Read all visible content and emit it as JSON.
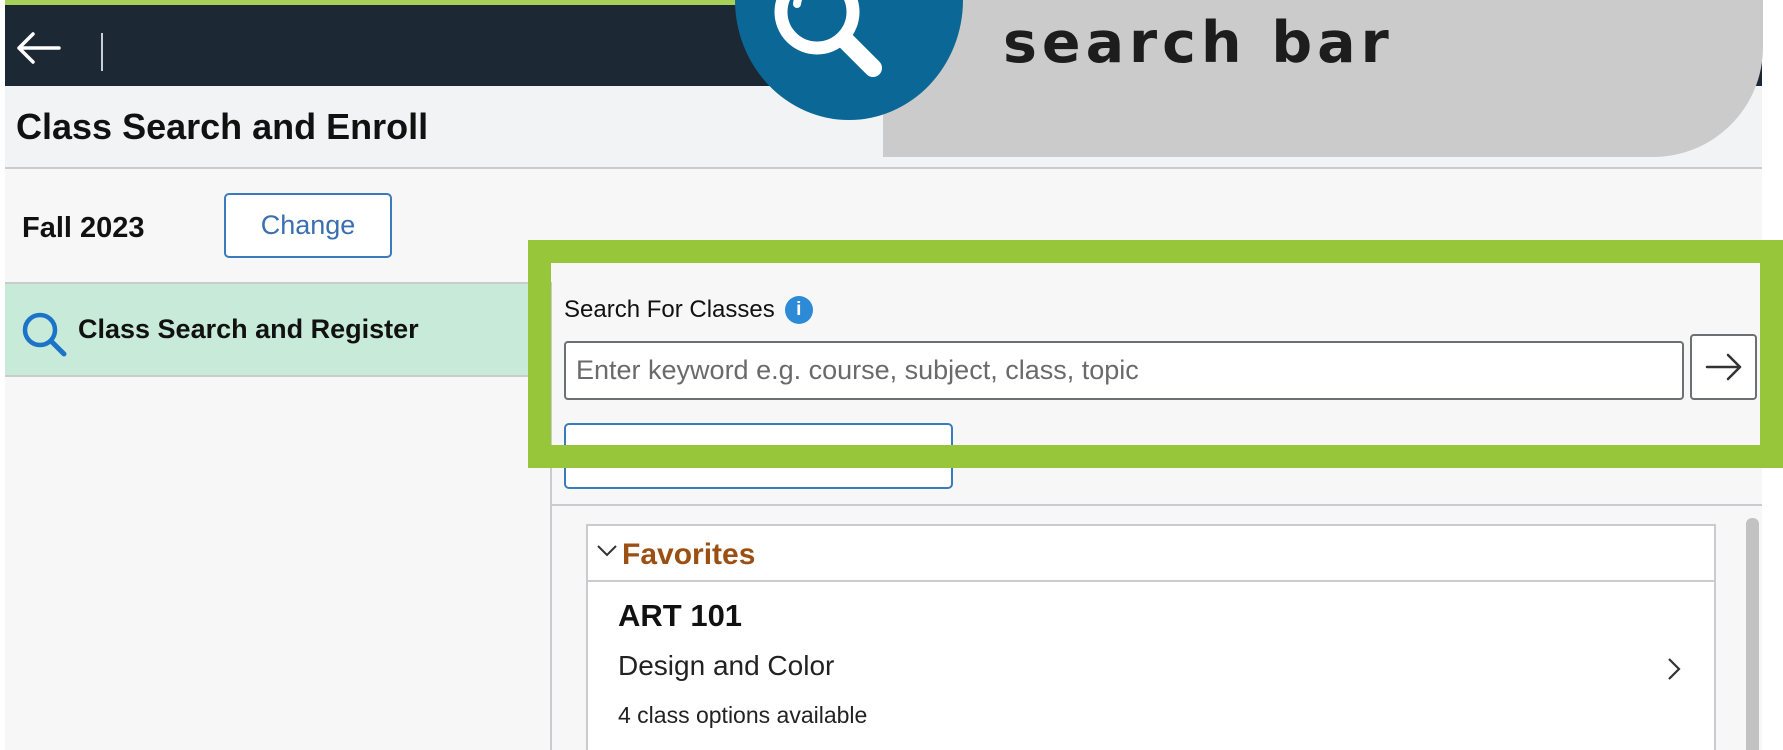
{
  "header": {
    "back_icon": "arrow-left-icon"
  },
  "page": {
    "title": "Class Search and Enroll"
  },
  "term": {
    "label": "Fall 2023",
    "change_label": "Change"
  },
  "nav": {
    "item_label": "Class Search and Register",
    "item_icon": "search-icon"
  },
  "search": {
    "label": "Search For Classes",
    "info_icon": "info-icon",
    "placeholder": "Enter keyword e.g. course, subject, class, topic",
    "value": "",
    "go_icon": "arrow-right-icon",
    "advanced_label": ""
  },
  "favorites": {
    "title": "Favorites",
    "items": [
      {
        "code": "ART 101",
        "name": "Design and Color",
        "options": "4 class options available"
      }
    ]
  },
  "callout": {
    "text": "search bar",
    "icon": "magnifier-icon"
  },
  "colors": {
    "topbar": "#1d2835",
    "highlight": "#97c63b",
    "nav_active": "#c8ead8",
    "callout_circle": "#0b6896",
    "callout_tab": "#cbcbcb",
    "favorites_title": "#9c4f12",
    "link_blue": "#3a6fb0"
  }
}
